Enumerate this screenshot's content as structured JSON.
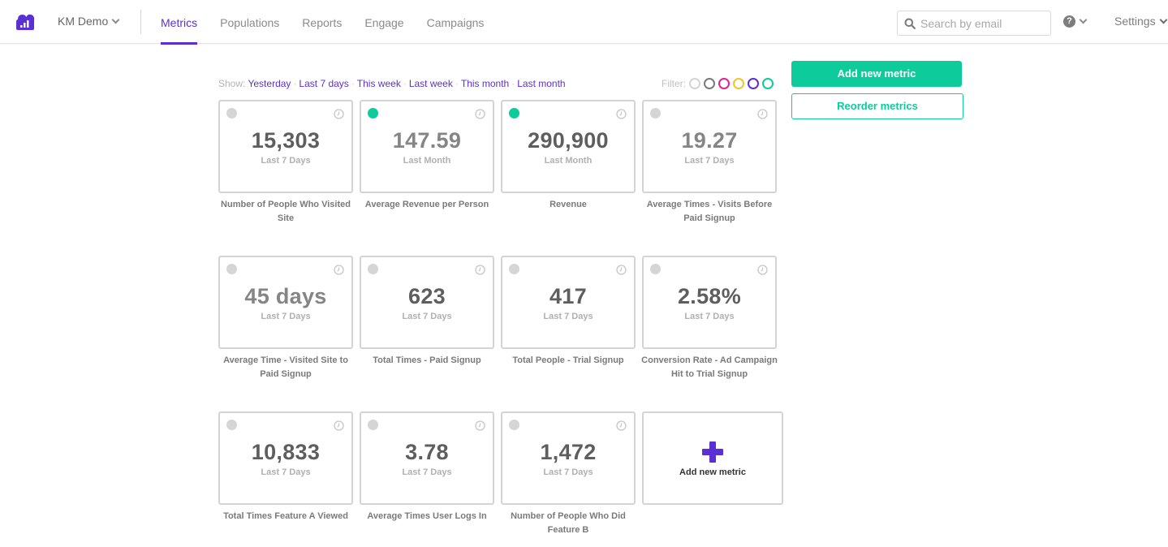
{
  "header": {
    "org_name": "KM Demo",
    "nav": [
      {
        "label": "Metrics",
        "active": true
      },
      {
        "label": "Populations",
        "active": false
      },
      {
        "label": "Reports",
        "active": false
      },
      {
        "label": "Engage",
        "active": false
      },
      {
        "label": "Campaigns",
        "active": false
      }
    ],
    "search_placeholder": "Search by email",
    "help_icon": "question-circle-icon",
    "settings_label": "Settings"
  },
  "colors": {
    "brand": "#5b2fd6",
    "accent": "#0dcb9a",
    "inactive_dot": "#d5d5d5"
  },
  "show": {
    "label": "Show:",
    "options": [
      "Yesterday",
      "Last 7 days",
      "This week",
      "Last week",
      "This month",
      "Last month"
    ]
  },
  "filter": {
    "label": "Filter:",
    "colors": [
      "#d4d4d4",
      "#7a7a7a",
      "#e0238f",
      "#f2c42c",
      "#5b2fd6",
      "#0dcb9a"
    ]
  },
  "actions": {
    "add_metric": "Add new metric",
    "reorder_metrics": "Reorder metrics"
  },
  "metrics": [
    {
      "value": "15,303",
      "period": "Last 7 Days",
      "name": "Number of People Who Visited Site",
      "active": false,
      "muted": false
    },
    {
      "value": "147.59",
      "period": "Last Month",
      "name": "Average Revenue per Person",
      "active": true,
      "muted": true
    },
    {
      "value": "290,900",
      "period": "Last Month",
      "name": "Revenue",
      "active": true,
      "muted": false
    },
    {
      "value": "19.27",
      "period": "Last 7 Days",
      "name": "Average Times - Visits Before Paid Signup",
      "active": false,
      "muted": true
    },
    {
      "value": "45 days",
      "period": "Last 7 Days",
      "name": "Average Time - Visited Site to Paid Signup",
      "active": false,
      "muted": true
    },
    {
      "value": "623",
      "period": "Last 7 Days",
      "name": "Total Times - Paid Signup",
      "active": false,
      "muted": false
    },
    {
      "value": "417",
      "period": "Last 7 Days",
      "name": "Total People - Trial Signup",
      "active": false,
      "muted": false
    },
    {
      "value": "2.58%",
      "period": "Last 7 Days",
      "name": "Conversion Rate - Ad Campaign Hit to Trial Signup",
      "active": false,
      "muted": false
    },
    {
      "value": "10,833",
      "period": "Last 7 Days",
      "name": "Total Times Feature A Viewed",
      "active": false,
      "muted": false
    },
    {
      "value": "3.78",
      "period": "Last 7 Days",
      "name": "Average Times User Logs In",
      "active": false,
      "muted": false
    },
    {
      "value": "1,472",
      "period": "Last 7 Days",
      "name": "Number of People Who Did Feature B",
      "active": false,
      "muted": false
    }
  ],
  "add_card_label": "Add new metric"
}
